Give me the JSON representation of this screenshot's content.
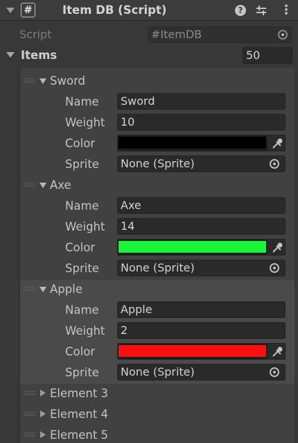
{
  "header": {
    "title": "Item DB (Script)",
    "script_glyph": "#",
    "icons": [
      "help-icon",
      "settings-sliders-icon",
      "kebab-menu-icon"
    ]
  },
  "script_row": {
    "label": "Script",
    "value": "ItemDB",
    "value_glyph": "#"
  },
  "items_row": {
    "label": "Items",
    "count": "50"
  },
  "field_labels": {
    "name": "Name",
    "weight": "Weight",
    "color": "Color",
    "sprite": "Sprite"
  },
  "elements": [
    {
      "title": "Sword",
      "name": "Sword",
      "weight": "10",
      "color": "#000000",
      "sprite": "None (Sprite)"
    },
    {
      "title": "Axe",
      "name": "Axe",
      "weight": "14",
      "color": "#1af53b",
      "sprite": "None (Sprite)"
    },
    {
      "title": "Apple",
      "name": "Apple",
      "weight": "2",
      "color": "#ff0f0f",
      "sprite": "None (Sprite)"
    }
  ],
  "collapsed": [
    "Element 3",
    "Element 4",
    "Element 5"
  ]
}
